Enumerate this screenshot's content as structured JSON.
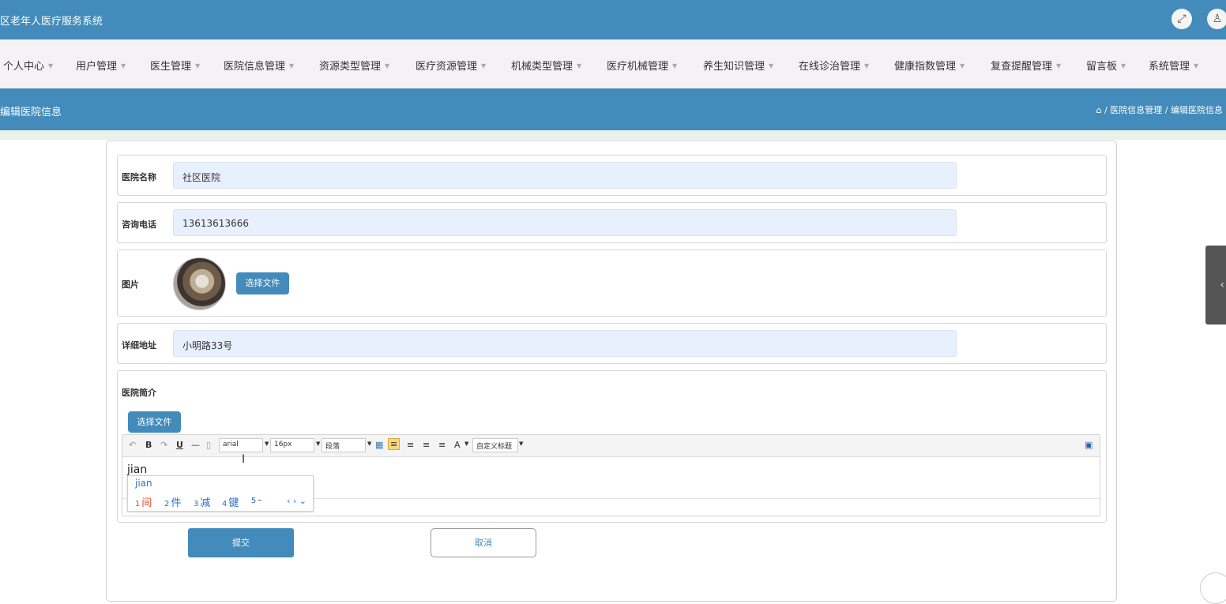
{
  "app": {
    "title": "区老年人医疗服务系统"
  },
  "topbar": {
    "fullscreen_icon": "expand-icon",
    "user_icon": "user-icon"
  },
  "nav": {
    "items": [
      "个人中心",
      "用户管理",
      "医生管理",
      "医院信息管理",
      "资源类型管理",
      "医疗资源管理",
      "机械类型管理",
      "医疗机械管理",
      "养生知识管理",
      "在线诊治管理",
      "健康指数管理",
      "复查提醒管理",
      "留言板",
      "系统管理"
    ]
  },
  "page": {
    "title": "编辑医院信息",
    "breadcrumb": "⌂ / 医院信息管理 / 编辑医院信息"
  },
  "form": {
    "name_label": "医院名称",
    "name_value": "社区医院",
    "phone_label": "咨询电话",
    "phone_value": "13613613666",
    "image_label": "图片",
    "image_button": "选择文件",
    "address_label": "详细地址",
    "address_value": "小明路33号",
    "intro_label": "医院简介",
    "intro_button": "选择文件",
    "submit_label": "提交",
    "cancel_label": "取消"
  },
  "editor": {
    "font_family": "arial",
    "font_size": "16px",
    "paragraph": "段落",
    "custom_title": "自定义标题",
    "content": "jian"
  },
  "ime": {
    "input": "jian",
    "candidates": [
      {
        "num": "1",
        "text": "间"
      },
      {
        "num": "2",
        "text": "件"
      },
      {
        "num": "3",
        "text": "减"
      },
      {
        "num": "4",
        "text": "键"
      },
      {
        "num": "5",
        "text": "-"
      }
    ]
  }
}
